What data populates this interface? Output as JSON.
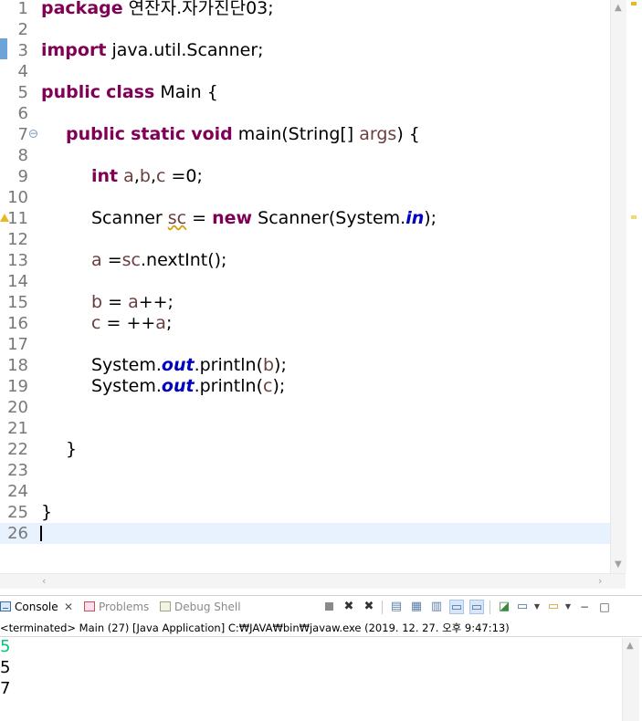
{
  "editor": {
    "lines": [
      {
        "n": "1",
        "parts": [
          {
            "t": "package",
            "c": "kw"
          },
          {
            "t": " 연잔자.자가진단03;",
            "c": ""
          }
        ]
      },
      {
        "n": "2",
        "parts": []
      },
      {
        "n": "3",
        "parts": [
          {
            "t": "import",
            "c": "kw"
          },
          {
            "t": " java.util.Scanner;",
            "c": ""
          }
        ]
      },
      {
        "n": "4",
        "parts": []
      },
      {
        "n": "5",
        "parts": [
          {
            "t": "public",
            "c": "kw"
          },
          {
            "t": " ",
            "c": ""
          },
          {
            "t": "class",
            "c": "kw"
          },
          {
            "t": " Main {",
            "c": ""
          }
        ]
      },
      {
        "n": "6",
        "parts": []
      },
      {
        "n": "7",
        "ind": 1,
        "parts": [
          {
            "t": "public",
            "c": "kw"
          },
          {
            "t": " ",
            "c": ""
          },
          {
            "t": "static",
            "c": "kw"
          },
          {
            "t": " ",
            "c": ""
          },
          {
            "t": "void",
            "c": "kw"
          },
          {
            "t": " main(String[] ",
            "c": ""
          },
          {
            "t": "args",
            "c": "var"
          },
          {
            "t": ") {",
            "c": ""
          }
        ]
      },
      {
        "n": "8",
        "parts": []
      },
      {
        "n": "9",
        "ind": 2,
        "parts": [
          {
            "t": "int",
            "c": "kw"
          },
          {
            "t": " ",
            "c": ""
          },
          {
            "t": "a",
            "c": "var"
          },
          {
            "t": ",",
            "c": ""
          },
          {
            "t": "b",
            "c": "var"
          },
          {
            "t": ",",
            "c": ""
          },
          {
            "t": "c",
            "c": "var"
          },
          {
            "t": " =0;",
            "c": ""
          }
        ]
      },
      {
        "n": "10",
        "parts": []
      },
      {
        "n": "11",
        "ind": 2,
        "parts": [
          {
            "t": "Scanner ",
            "c": ""
          },
          {
            "t": "sc",
            "c": "var warnul"
          },
          {
            "t": " = ",
            "c": ""
          },
          {
            "t": "new",
            "c": "kw"
          },
          {
            "t": " Scanner(System.",
            "c": ""
          },
          {
            "t": "in",
            "c": "sfield"
          },
          {
            "t": ");",
            "c": ""
          }
        ]
      },
      {
        "n": "12",
        "parts": []
      },
      {
        "n": "13",
        "ind": 2,
        "parts": [
          {
            "t": "a",
            "c": "var"
          },
          {
            "t": " =",
            "c": ""
          },
          {
            "t": "sc",
            "c": "var"
          },
          {
            "t": ".nextInt();",
            "c": ""
          }
        ]
      },
      {
        "n": "14",
        "parts": []
      },
      {
        "n": "15",
        "ind": 2,
        "parts": [
          {
            "t": "b",
            "c": "var"
          },
          {
            "t": " = ",
            "c": ""
          },
          {
            "t": "a",
            "c": "var"
          },
          {
            "t": "++;",
            "c": ""
          }
        ]
      },
      {
        "n": "16",
        "ind": 2,
        "parts": [
          {
            "t": "c",
            "c": "var"
          },
          {
            "t": " = ++",
            "c": ""
          },
          {
            "t": "a",
            "c": "var"
          },
          {
            "t": ";",
            "c": ""
          }
        ]
      },
      {
        "n": "17",
        "parts": []
      },
      {
        "n": "18",
        "ind": 2,
        "parts": [
          {
            "t": "System.",
            "c": ""
          },
          {
            "t": "out",
            "c": "sfield"
          },
          {
            "t": ".println(",
            "c": ""
          },
          {
            "t": "b",
            "c": "var"
          },
          {
            "t": ");",
            "c": ""
          }
        ]
      },
      {
        "n": "19",
        "ind": 2,
        "parts": [
          {
            "t": "System.",
            "c": ""
          },
          {
            "t": "out",
            "c": "sfield"
          },
          {
            "t": ".println(",
            "c": ""
          },
          {
            "t": "c",
            "c": "var"
          },
          {
            "t": ");",
            "c": ""
          }
        ]
      },
      {
        "n": "20",
        "parts": []
      },
      {
        "n": "21",
        "parts": []
      },
      {
        "n": "22",
        "ind": 1,
        "parts": [
          {
            "t": "}",
            "c": ""
          }
        ]
      },
      {
        "n": "23",
        "parts": []
      },
      {
        "n": "24",
        "parts": []
      },
      {
        "n": "25",
        "parts": [
          {
            "t": "}",
            "c": ""
          }
        ]
      },
      {
        "n": "26",
        "parts": [],
        "current": true
      }
    ]
  },
  "console": {
    "tabs": [
      {
        "id": "console",
        "label": "Console",
        "close": "✕"
      },
      {
        "id": "problems",
        "label": "Problems"
      },
      {
        "id": "debug",
        "label": "Debug Shell"
      }
    ],
    "status": "<terminated> Main (27) [Java Application] C:₩JAVA₩bin₩javaw.exe (2019. 12. 27. 오후 9:47:13)",
    "output": [
      {
        "text": "5",
        "kind": "input"
      },
      {
        "text": "5",
        "kind": "stdout"
      },
      {
        "text": "7",
        "kind": "stdout"
      }
    ]
  },
  "colors": {
    "keyword": "#7f0055",
    "variable": "#6a3e3e",
    "static_field": "#0000c0",
    "console_input": "#00c87a",
    "current_line": "#e8f2fe"
  }
}
